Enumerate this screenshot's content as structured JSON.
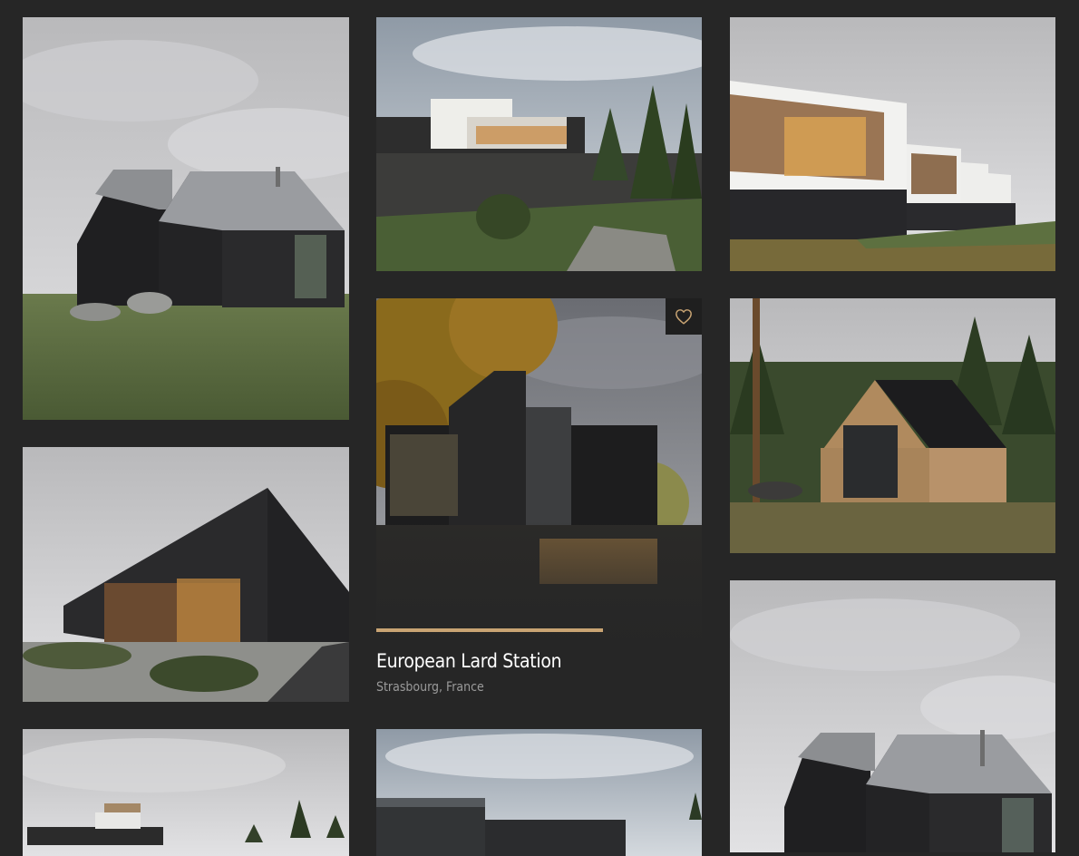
{
  "colors": {
    "background": "#262626",
    "accent": "#c9a473",
    "title": "#ffffff",
    "subtitle": "#9a9a9a"
  },
  "gallery": {
    "items": [
      {
        "image": "black-gabled-cabin-meadow"
      },
      {
        "image": "dark-brick-longhouse"
      },
      {
        "image": "terraced-villa-pines"
      },
      {
        "image": "terraced-villa-stairs"
      },
      {
        "image": "black-timber-station-autumn",
        "title": "European Lard Station",
        "subtitle": "Strasbourg, France",
        "favorite_icon": "heart-outline-icon",
        "highlighted": true
      },
      {
        "image": "flat-roof-house-sky"
      },
      {
        "image": "wood-slat-row-houses"
      },
      {
        "image": "timber-a-frame-forest"
      },
      {
        "image": "black-gabled-cabin-closeup"
      }
    ]
  }
}
